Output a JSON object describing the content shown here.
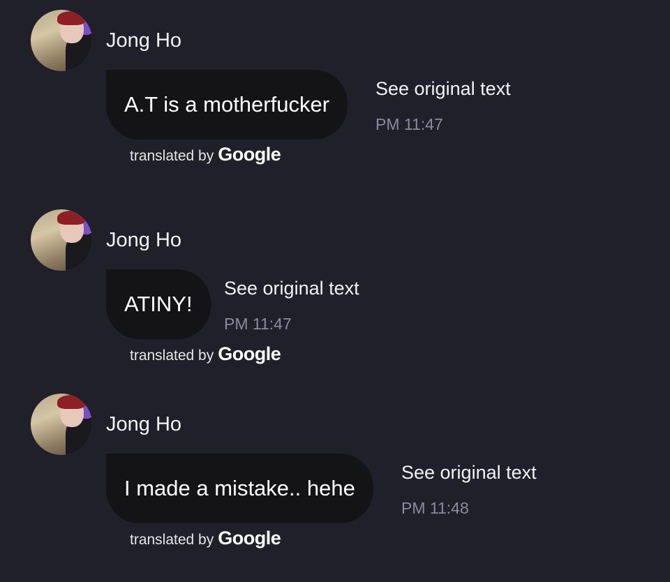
{
  "messages": [
    {
      "sender": "Jong Ho",
      "text": "A.T is a motherfucker",
      "see_original": "See original text",
      "time": "PM 11:47",
      "translated_by": "translated by",
      "translator": "Google"
    },
    {
      "sender": "Jong Ho",
      "text": "ATINY!",
      "see_original": "See original text",
      "time": "PM 11:47",
      "translated_by": "translated by",
      "translator": "Google"
    },
    {
      "sender": "Jong Ho",
      "text": "I made a mistake.. hehe",
      "see_original": "See original text",
      "time": "PM 11:48",
      "translated_by": "translated by",
      "translator": "Google"
    }
  ],
  "colors": {
    "background": "#20202a",
    "bubble": "#141416",
    "timestamp": "#8a8aa0",
    "text": "#ffffff"
  }
}
